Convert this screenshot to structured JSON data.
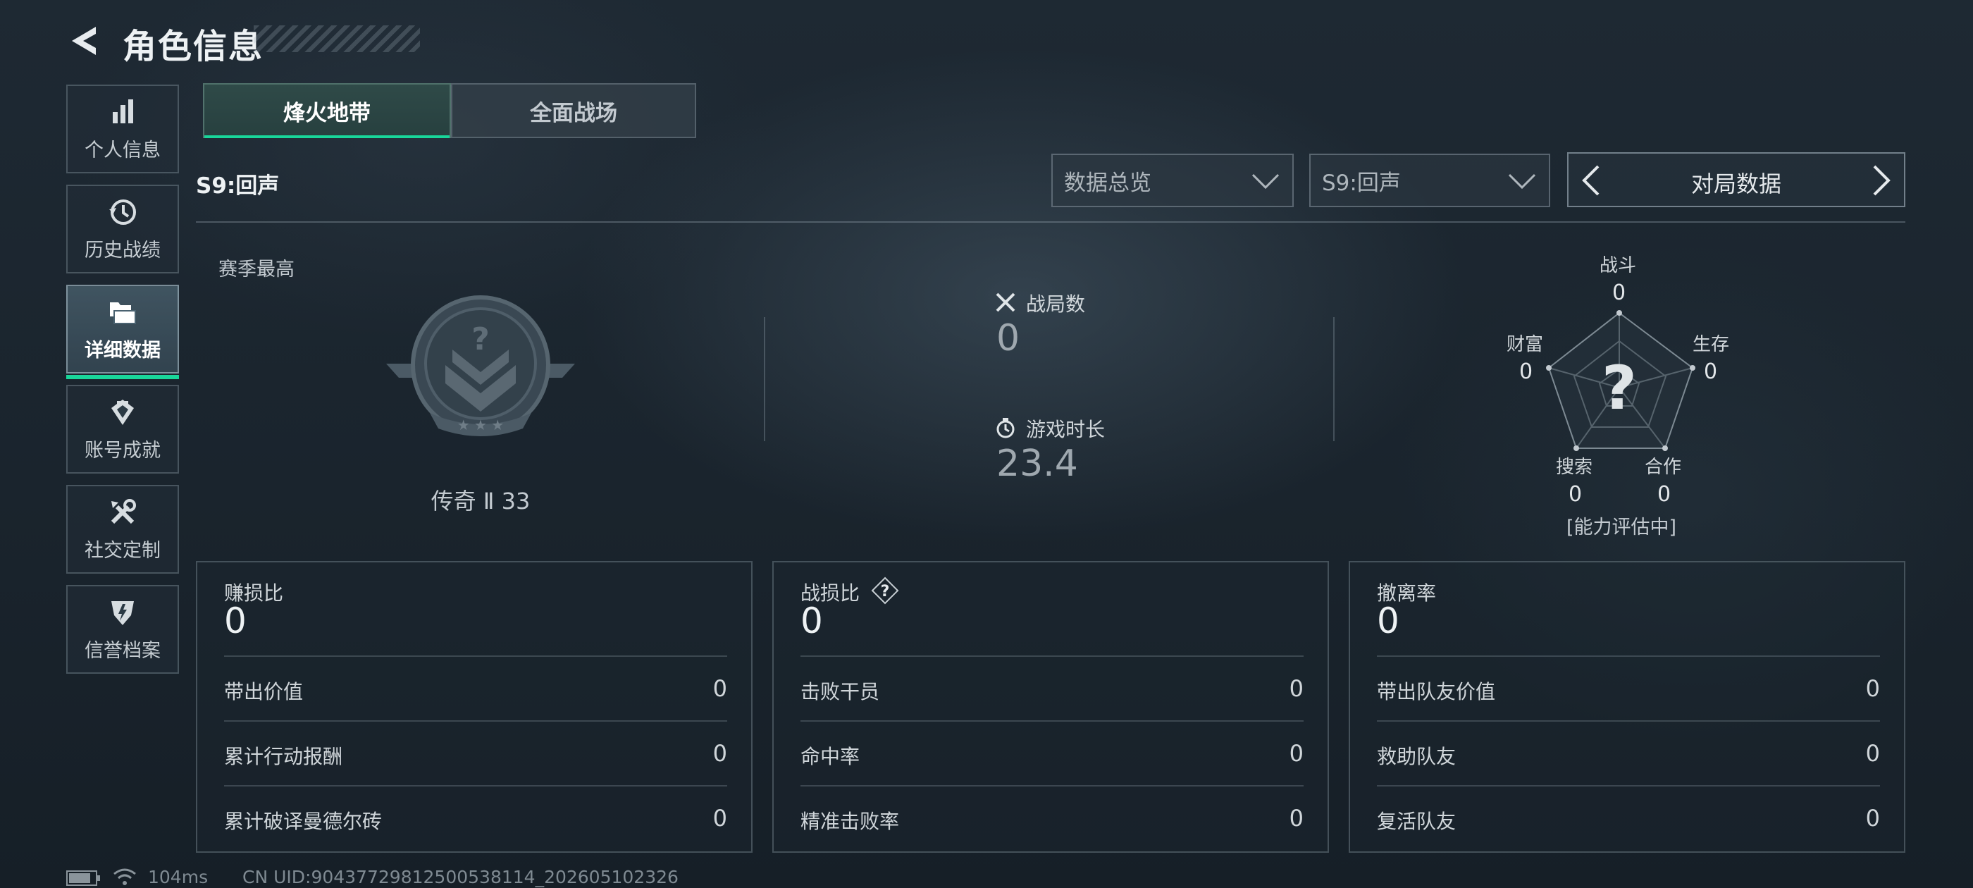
{
  "header": {
    "title": "角色信息"
  },
  "sidebar": {
    "items": [
      {
        "label": "个人信息",
        "icon": "bar-chart-icon",
        "active": false
      },
      {
        "label": "历史战绩",
        "icon": "history-icon",
        "active": false
      },
      {
        "label": "详细数据",
        "icon": "folders-icon",
        "active": true
      },
      {
        "label": "账号成就",
        "icon": "achievement-icon",
        "active": false
      },
      {
        "label": "社交定制",
        "icon": "tools-icon",
        "active": false
      },
      {
        "label": "信誉档案",
        "icon": "shield-icon",
        "active": false
      }
    ]
  },
  "tabs": [
    {
      "label": "烽火地带",
      "active": true
    },
    {
      "label": "全面战场",
      "active": false
    }
  ],
  "season_label": "S9:回声",
  "filters": {
    "view_select": "数据总览",
    "season_select": "S9:回声",
    "pager_label": "对局数据"
  },
  "season_best": {
    "label": "赛季最高",
    "rank_text": "传奇 Ⅱ 33"
  },
  "stats": {
    "matches_label": "战局数",
    "matches_value": "0",
    "playtime_label": "游戏时长",
    "playtime_value": "23.4"
  },
  "radar": {
    "combat": {
      "label": "战斗",
      "value": "0"
    },
    "survival": {
      "label": "生存",
      "value": "0"
    },
    "teamwork": {
      "label": "合作",
      "value": "0"
    },
    "search": {
      "label": "搜索",
      "value": "0"
    },
    "wealth": {
      "label": "财富",
      "value": "0"
    },
    "status": "[能力评估中]"
  },
  "cards": [
    {
      "title": "赚损比",
      "value": "0",
      "rows": [
        {
          "name": "带出价值",
          "value": "0"
        },
        {
          "name": "累计行动报酬",
          "value": "0"
        },
        {
          "name": "累计破译曼德尔砖",
          "value": "0"
        }
      ]
    },
    {
      "title": "战损比",
      "value": "0",
      "rows": [
        {
          "name": "击败干员",
          "value": "0"
        },
        {
          "name": "命中率",
          "value": "0"
        },
        {
          "name": "精准击败率",
          "value": "0"
        }
      ]
    },
    {
      "title": "撤离率",
      "value": "0",
      "rows": [
        {
          "name": "带出队友价值",
          "value": "0"
        },
        {
          "name": "救助队友",
          "value": "0"
        },
        {
          "name": "复活队友",
          "value": "0"
        }
      ]
    }
  ],
  "footer": {
    "ping": "104ms",
    "uid": "CN UID:9043772981250053811​4_202605102326"
  },
  "colors": {
    "accent": "#19d69a",
    "background": "#1a242d"
  }
}
